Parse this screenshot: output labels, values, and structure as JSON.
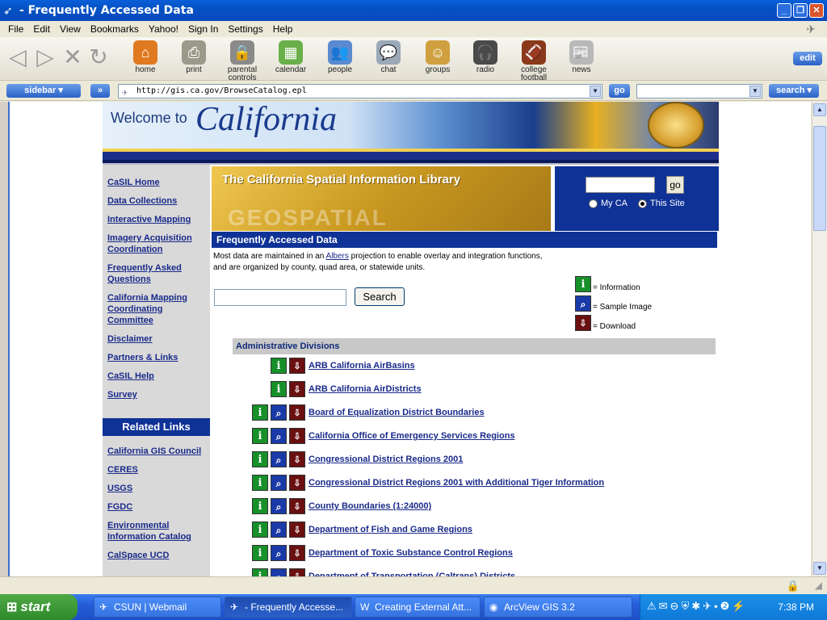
{
  "window": {
    "title": "- Frequently Accessed Data"
  },
  "menu": [
    "File",
    "Edit",
    "View",
    "Bookmarks",
    "Yahoo!",
    "Sign In",
    "Settings",
    "Help"
  ],
  "toolbar": {
    "items": [
      {
        "label1": "home",
        "label2": ""
      },
      {
        "label1": "print",
        "label2": ""
      },
      {
        "label1": "parental",
        "label2": "controls"
      },
      {
        "label1": "calendar",
        "label2": ""
      },
      {
        "label1": "people",
        "label2": ""
      },
      {
        "label1": "chat",
        "label2": ""
      },
      {
        "label1": "groups",
        "label2": ""
      },
      {
        "label1": "radio",
        "label2": ""
      },
      {
        "label1": "college",
        "label2": "football"
      },
      {
        "label1": "news",
        "label2": ""
      }
    ],
    "edit_label": "edit"
  },
  "addressbar": {
    "sidebar_label": "sidebar",
    "forward_label": "»",
    "url": "http://gis.ca.gov/BrowseCatalog.epl",
    "go_label": "go",
    "search_label": "search"
  },
  "banner": {
    "welcome": "Welcome to",
    "state": "California"
  },
  "sidenav": {
    "items": [
      {
        "line1": "CaSIL Home",
        "line2": "",
        "line3": ""
      },
      {
        "line1": "Data Collections",
        "line2": "",
        "line3": ""
      },
      {
        "line1": "Interactive Mapping",
        "line2": "",
        "line3": ""
      },
      {
        "line1": "Imagery Acquisition",
        "line2": "Coordination",
        "line3": ""
      },
      {
        "line1": "Frequently Asked",
        "line2": "Questions",
        "line3": ""
      },
      {
        "line1": "California Mapping",
        "line2": "Coordinating",
        "line3": "Committee"
      },
      {
        "line1": "Disclaimer",
        "line2": "",
        "line3": ""
      },
      {
        "line1": "Partners & Links",
        "line2": "",
        "line3": ""
      },
      {
        "line1": "CaSIL Help",
        "line2": "",
        "line3": ""
      },
      {
        "line1": "Survey",
        "line2": "",
        "line3": ""
      }
    ],
    "related_heading": "Related Links",
    "related": [
      {
        "line1": "California GIS Council",
        "line2": ""
      },
      {
        "line1": "CERES",
        "line2": ""
      },
      {
        "line1": "USGS",
        "line2": ""
      },
      {
        "line1": "FGDC",
        "line2": ""
      },
      {
        "line1": "Environmental",
        "line2": "Information Catalog"
      },
      {
        "line1": "CalSpace UCD",
        "line2": ""
      }
    ]
  },
  "library": {
    "title": "The California Spatial Information Library",
    "watermark": "GEOSPATIAL"
  },
  "site_search": {
    "go_label": "go",
    "option_myca": "My CA",
    "option_site": "This Site"
  },
  "page": {
    "heading": "Frequently Accessed Data",
    "intro_before": "Most data are maintained in an ",
    "intro_link": "Albers",
    "intro_after": " projection to enable overlay and integration functions,",
    "intro_line2": "and are organized by county, quad area, or statewide units.",
    "search_button": "Search"
  },
  "legend": {
    "info": "= Information",
    "sample": "= Sample Image",
    "download": "= Download"
  },
  "catalog": {
    "section": "Administrative Divisions",
    "items": [
      {
        "label": "ARB California AirBasins",
        "sample": false
      },
      {
        "label": "ARB California AirDistricts",
        "sample": false
      },
      {
        "label": "Board of Equalization District Boundaries",
        "sample": true
      },
      {
        "label": "California Office of Emergency Services Regions",
        "sample": true
      },
      {
        "label": "Congressional District Regions 2001",
        "sample": true
      },
      {
        "label": "Congressional District Regions 2001 with Additional Tiger Information",
        "sample": true
      },
      {
        "label": "County Boundaries (1:24000)",
        "sample": true
      },
      {
        "label": "Department of Fish and Game Regions",
        "sample": true
      },
      {
        "label": "Department of Toxic Substance Control Regions",
        "sample": true
      },
      {
        "label": "Department of Transportation (Caltrans) Districts",
        "sample": true
      }
    ]
  },
  "taskbar": {
    "start": "start",
    "tasks": [
      "CSUN | Webmail",
      "- Frequently Accesse...",
      "Creating External Att...",
      "ArcView GIS 3.2"
    ],
    "clock": "7:38 PM"
  },
  "colors": {
    "accent": "#0f3296",
    "link": "#1a2a8a",
    "info": "#17902a",
    "sample": "#1a3aa8",
    "download": "#6a1010"
  }
}
